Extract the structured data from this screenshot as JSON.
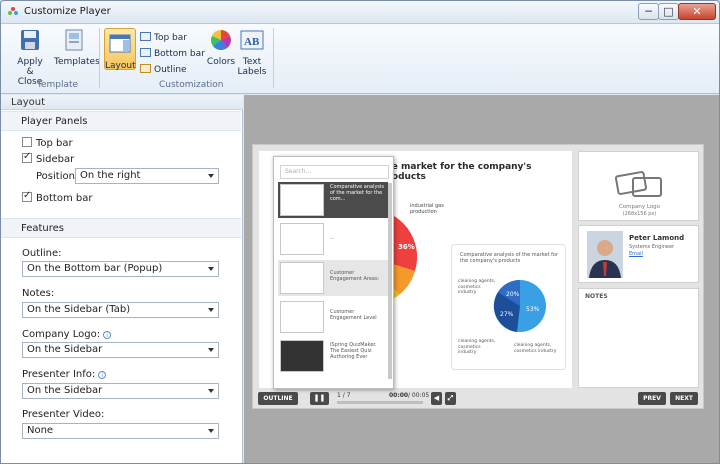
{
  "window": {
    "title": "Customize Player",
    "min": "─",
    "max": "□",
    "close": "✕"
  },
  "ribbon": {
    "apply_close": "Apply & Close",
    "templates": "Templates",
    "layout": "Layout",
    "top_bar": "Top bar",
    "bottom_bar": "Bottom bar",
    "outline": "Outline",
    "colors": "Colors",
    "text_labels": "Text Labels",
    "group_template": "Template",
    "group_customization": "Customization"
  },
  "panel": {
    "header": "Layout",
    "player_panels": "Player Panels",
    "top_bar": "Top bar",
    "top_bar_checked": false,
    "sidebar": "Sidebar",
    "sidebar_checked": true,
    "position_label": "Position:",
    "position_value": "On the right",
    "bottom_bar": "Bottom bar",
    "bottom_bar_checked": true,
    "features": "Features",
    "outline_label": "Outline:",
    "outline_value": "On the Bottom bar  (Popup)",
    "notes_label": "Notes:",
    "notes_value": "On the Sidebar (Tab)",
    "logo_label": "Company Logo:",
    "logo_value": "On the Sidebar",
    "presenter_label": "Presenter Info:",
    "presenter_value": "On the Sidebar",
    "video_label": "Presenter Video:",
    "video_value": "None",
    "info_glyph": "i"
  },
  "preview": {
    "slide_title": "the market for the company's products",
    "search_placeholder": "Search...",
    "thumbs": [
      "Comparative analysis of the market for the com...",
      "...",
      "Customer Engagement Areas:",
      "Customer Engagement Level",
      "iSpring QuizMaker. The Easiest Quiz Authoring Ever"
    ],
    "pie_pct": "36%",
    "industrial_label": "industrial gas production",
    "chart_title": "Comparative analysis of the market for the company's products",
    "cleaning_label": "cleaning agents, cosmetics industry",
    "small_pie": {
      "a": "20%",
      "b": "27%",
      "c": "53%"
    },
    "logo_caption": "Company Logo",
    "logo_size": "(268x156 px)",
    "presenter_name": "Peter Lamond",
    "presenter_role": "Systems Engineer",
    "presenter_email": "Email",
    "notes_title": "NOTES",
    "outline_btn": "OUTLINE",
    "slide_counter": "1 / 7",
    "time_current": "00:00",
    "time_total": "/ 00:05",
    "prev": "PREV",
    "next": "NEXT"
  }
}
